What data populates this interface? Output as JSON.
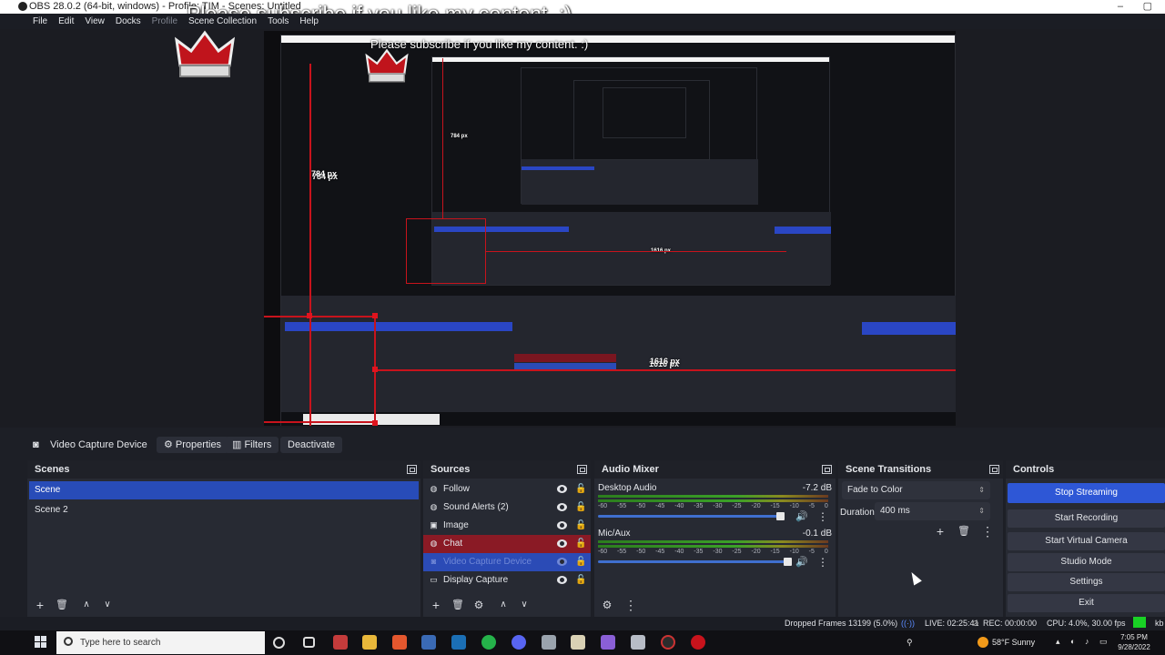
{
  "window": {
    "title": "OBS 28.0.2 (64-bit, windows) - Profile: TIM - Scenes: Untitled",
    "overlay_text": "Please subscribe if you like my content. :)"
  },
  "menu": [
    "File",
    "Edit",
    "View",
    "Docks",
    "Profile",
    "Scene Collection",
    "Tools",
    "Help"
  ],
  "preview": {
    "measure_vertical": "784 px",
    "measure_horizontal": "1616 px",
    "nested_measure_vertical": "784 px",
    "nested_measure_horizontal": "1616 px",
    "nested_overlay_text": "Please subscribe if you like my content. :)"
  },
  "source_bar": {
    "source_name": "Video Capture Device",
    "properties_label": "Properties",
    "filters_label": "Filters",
    "deactivate_label": "Deactivate"
  },
  "scenes": {
    "title": "Scenes",
    "items": [
      "Scene",
      "Scene 2"
    ],
    "selected_index": 0
  },
  "sources": {
    "title": "Sources",
    "items": [
      {
        "label": "Follow",
        "icon": "browser-icon"
      },
      {
        "label": "Sound Alerts (2)",
        "icon": "browser-icon"
      },
      {
        "label": "Image",
        "icon": "image-icon"
      },
      {
        "label": "Chat",
        "icon": "browser-icon"
      },
      {
        "label": "Video Capture Device",
        "icon": "camera-icon"
      },
      {
        "label": "Display Capture",
        "icon": "monitor-icon"
      }
    ]
  },
  "mixer": {
    "title": "Audio Mixer",
    "channels": [
      {
        "name": "Desktop Audio",
        "db": "-7.2 dB",
        "level": 0.96
      },
      {
        "name": "Mic/Aux",
        "db": "-0.1 dB",
        "level": 1.0
      }
    ],
    "ticks": "-60 -55 -50 -45 -40 -35 -30 -25 -20 -15 -10 -5 0"
  },
  "transitions": {
    "title": "Scene Transitions",
    "transition": "Fade to Color",
    "duration_label": "Duration",
    "duration_value": "400 ms"
  },
  "controls": {
    "title": "Controls",
    "buttons": [
      "Stop Streaming",
      "Start Recording",
      "Start Virtual Camera",
      "Studio Mode",
      "Settings",
      "Exit"
    ]
  },
  "status": {
    "dropped": "Dropped Frames 13199 (5.0%)",
    "live": "LIVE: 02:25:41",
    "rec": "REC: 00:00:00",
    "cpu": "CPU: 4.0%, 30.00 fps",
    "kb": "kb"
  },
  "taskbar": {
    "search_placeholder": "Type here to search",
    "weather": "58°F  Sunny",
    "time": "7:05 PM",
    "date": "9/28/2022"
  },
  "colors": {
    "accent_blue": "#284cb8",
    "chat_red": "#8a1a25",
    "record_green": "#19d125",
    "guide_red": "#c8131c"
  }
}
